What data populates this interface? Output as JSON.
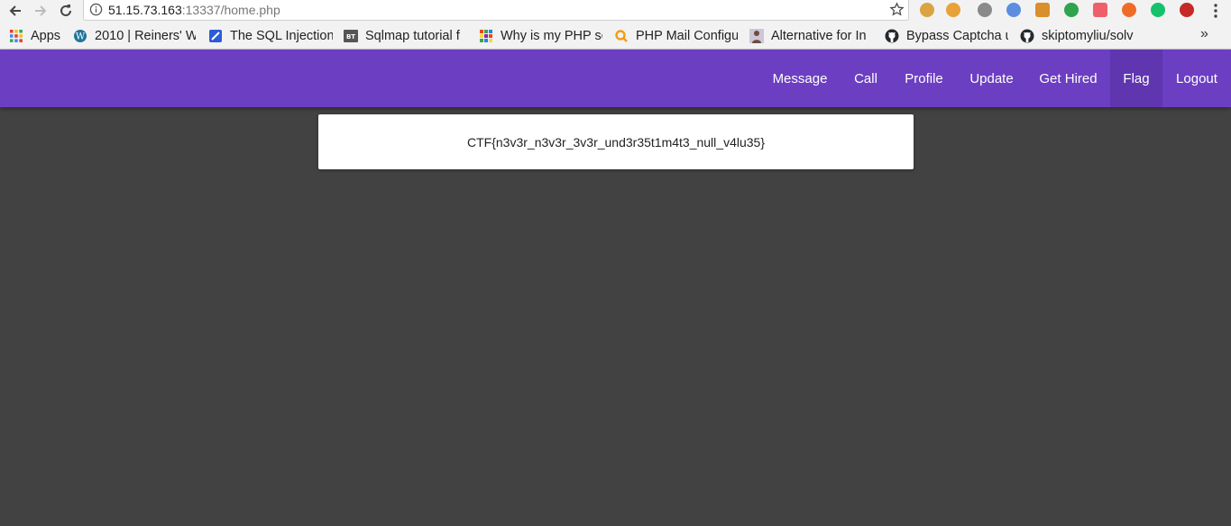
{
  "browser": {
    "url_host": "51.15.73.163",
    "url_rest": ":13337/home.php",
    "bookmarks": [
      {
        "label": "Apps",
        "icon": "apps-grid-icon",
        "color": "#e53935"
      },
      {
        "label": "2010 | Reiners' W",
        "icon": "wordpress-icon",
        "color": "#21759b"
      },
      {
        "label": "The SQL Injection",
        "icon": "sqli-icon",
        "color": "#2b5bd7"
      },
      {
        "label": "Sqlmap tutorial f",
        "icon": "bt-icon",
        "color": "#555555"
      },
      {
        "label": "Why is my PHP sc",
        "icon": "grid-icon",
        "color": "#e64a19"
      },
      {
        "label": "PHP Mail Configu",
        "icon": "search-q-icon",
        "color": "#f39c12"
      },
      {
        "label": "Alternative for In",
        "icon": "person-icon",
        "color": "#6d4c41"
      },
      {
        "label": "Bypass Captcha u",
        "icon": "github-icon",
        "color": "#24292e"
      },
      {
        "label": "skiptomyliu/solv",
        "icon": "github-icon",
        "color": "#24292e"
      }
    ],
    "more": "»"
  },
  "navbar": {
    "items": [
      "Message",
      "Call",
      "Profile",
      "Update",
      "Get Hired",
      "Flag",
      "Logout"
    ],
    "active": "Flag",
    "color": "#6c3ec2"
  },
  "content": {
    "flag_text": "CTF{n3v3r_n3v3r_3v3r_und3r35t1m4t3_null_v4lu35}"
  }
}
